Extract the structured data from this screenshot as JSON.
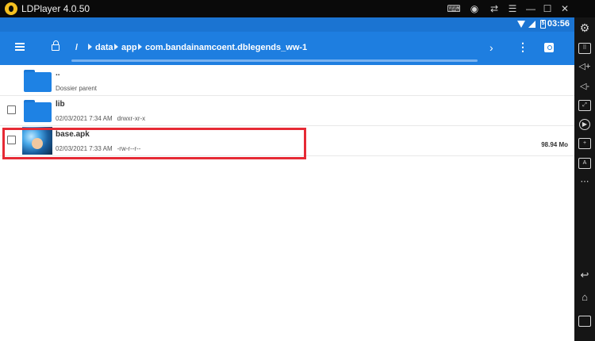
{
  "window": {
    "title": "LDPlayer 4.0.50",
    "icons": [
      "gamepad-icon",
      "account-icon",
      "sync-icon",
      "menu-icon",
      "minimize-icon",
      "maximize-icon",
      "close-icon"
    ],
    "minimize_glyph": "—",
    "maximize_glyph": "☐",
    "close_glyph": "✕"
  },
  "status_bar": {
    "time": "03:56",
    "battery_label": "5"
  },
  "app_bar": {
    "breadcrumb": [
      "/",
      "data",
      "app",
      "com.bandainamcoent.dblegends_ww-1"
    ],
    "chevron": "›",
    "overflow": "⋮"
  },
  "files": [
    {
      "name": "..",
      "date": "Dossier parent",
      "permissions": "",
      "size": "",
      "type": "folder",
      "checkbox": false
    },
    {
      "name": "lib",
      "date": "02/03/2021 7:34 AM",
      "permissions": "drwxr-xr-x",
      "size": "",
      "type": "folder",
      "checkbox": true
    },
    {
      "name": "base.apk",
      "date": "02/03/2021 7:33 AM",
      "permissions": "-rw-r--r--",
      "size": "98.94 Mo",
      "type": "apk",
      "checkbox": true,
      "highlighted": true
    }
  ],
  "colors": {
    "status_bar": "#1b74d2",
    "app_bar": "#1e7ee0",
    "folder": "#1e82e4",
    "highlight": "#e62a35"
  }
}
